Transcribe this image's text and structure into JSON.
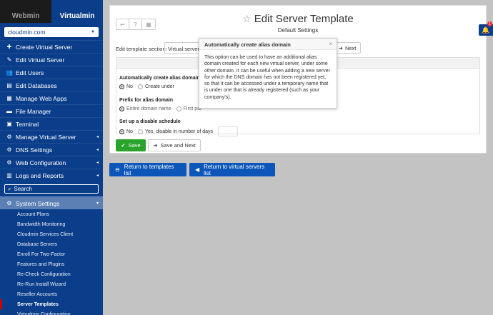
{
  "sidebar": {
    "tabs": {
      "webmin": "Webmin",
      "virtualmin": "Virtualmin"
    },
    "domain": "cloudmin.com",
    "items": [
      {
        "icon": "plus-icon",
        "glyph": "✚",
        "label": "Create Virtual Server",
        "arrow": ""
      },
      {
        "icon": "edit-icon",
        "glyph": "✎",
        "label": "Edit Virtual Server",
        "arrow": ""
      },
      {
        "icon": "users-icon",
        "glyph": "👥",
        "label": "Edit Users",
        "arrow": ""
      },
      {
        "icon": "database-icon",
        "glyph": "▤",
        "label": "Edit Databases",
        "arrow": ""
      },
      {
        "icon": "apps-icon",
        "glyph": "▦",
        "label": "Manage Web Apps",
        "arrow": ""
      },
      {
        "icon": "folder-icon",
        "glyph": "▬",
        "label": "File Manager",
        "arrow": ""
      },
      {
        "icon": "terminal-icon",
        "glyph": "▣",
        "label": "Terminal",
        "arrow": ""
      },
      {
        "icon": "server-icon",
        "glyph": "⚙",
        "label": "Manage Virtual Server",
        "arrow": "◂"
      },
      {
        "icon": "dns-icon",
        "glyph": "⚙",
        "label": "DNS Settings",
        "arrow": "◂"
      },
      {
        "icon": "web-icon",
        "glyph": "⚙",
        "label": "Web Configuration",
        "arrow": "◂"
      },
      {
        "icon": "reports-icon",
        "glyph": "▥",
        "label": "Logs and Reports",
        "arrow": "◂"
      }
    ],
    "search_placeholder": "Search",
    "system_settings": "System Settings",
    "sub_items": [
      "Account Plans",
      "Bandwidth Monitoring",
      "Cloudmin Services Client",
      "Database Servers",
      "Enroll For Two-Factor",
      "Features and Plugins",
      "Re-Check Configuration",
      "Re-Run Install Wizard",
      "Reseller Accounts",
      "Server Templates",
      "Virtualmin Configuration"
    ],
    "active_sub_item": "Server Templates"
  },
  "header": {
    "title": "Edit Server Template",
    "subtitle": "Default Settings"
  },
  "form": {
    "section_label": "Edit template section:",
    "section_value": "Virtual server",
    "next_label": "Next",
    "alias_label": "Automatically create alias domain",
    "alias_options": [
      "No",
      "Create under"
    ],
    "prefix_label": "Prefix for alias domain",
    "prefix_options": [
      "Entire domain name",
      "First par"
    ],
    "disable_label": "Set up a disable schedule",
    "disable_options": [
      "No",
      "Yes, disable in number of days"
    ],
    "save_label": "Save",
    "save_next_label": "Save and Next"
  },
  "popover": {
    "title": "Automatically create alias domain",
    "close": "×",
    "body": "This option can be used to have an additional alias domain created for each new virtual server, under some other domain. It can be useful when adding a new server for which the DNS domain has not been registered yet, so that it can be accessed under a temporary name that is under one that is already registered (such as your company's)."
  },
  "bottom": {
    "templates_btn": "Return to templates list",
    "servers_btn": "Return to virtual servers list"
  },
  "notifications": {
    "count": "1"
  },
  "colors": {
    "sidebar": "#0b3e8a",
    "save": "#2aa32a",
    "action": "#0b56b8"
  }
}
